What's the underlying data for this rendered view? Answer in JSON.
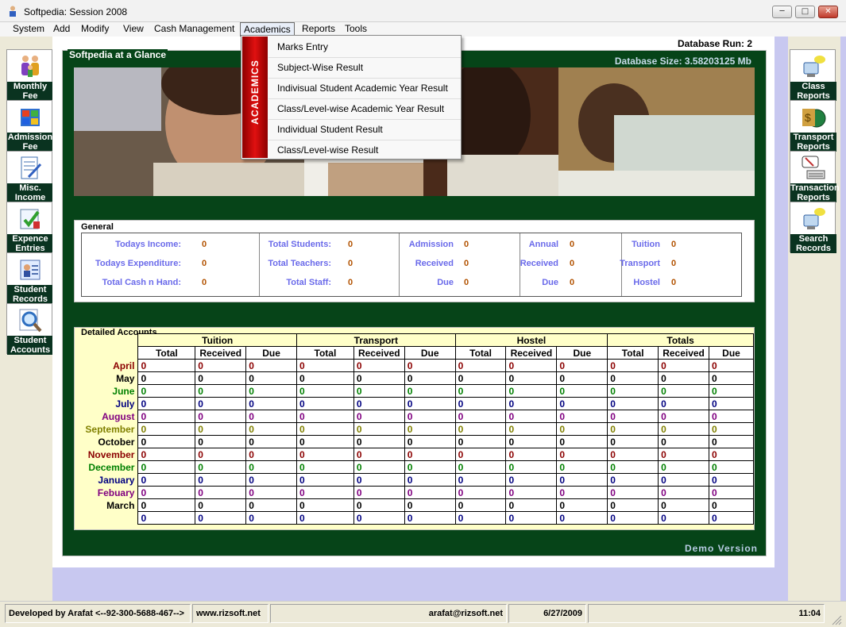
{
  "window": {
    "title": "Softpedia:  Session 2008",
    "min": "─",
    "max": "□",
    "close": "✕"
  },
  "menubar": [
    "System",
    "Add",
    "Modify",
    "View",
    "Cash Management",
    "Academics",
    "Reports",
    "Tools"
  ],
  "academics_menu": {
    "side_label": "ACADEMICS",
    "items": [
      "Marks Entry",
      "Subject-Wise Result",
      "Indivisual Student Academic Year Result",
      "Class/Level-wise Academic Year Result",
      "Individual Student Result",
      "Class/Level-wise Result"
    ]
  },
  "left_toolbar": [
    {
      "label": "Monthly Fee",
      "icon": "family-icon"
    },
    {
      "label": "Admission Fee",
      "icon": "windows-icon"
    },
    {
      "label": "Misc. Income",
      "icon": "document-edit-icon"
    },
    {
      "label": "Expence Entries",
      "icon": "checkbox-chart-icon"
    },
    {
      "label": "Student Records",
      "icon": "id-card-icon"
    },
    {
      "label": "Student Accounts",
      "icon": "magnifier-icon"
    }
  ],
  "right_toolbar": [
    {
      "label": "Class Reports",
      "icon": "computer-chat-icon"
    },
    {
      "label": "Transport Reports",
      "icon": "globe-money-icon"
    },
    {
      "label": "Transaction Reports",
      "icon": "keyboard-chat-icon"
    },
    {
      "label": "Search Records",
      "icon": "computer-search-icon"
    }
  ],
  "main": {
    "database_run": "Database Run: 2",
    "glance_title": "Softpedia at a Glance",
    "database_size": "Database Size: 3.58203125  Mb",
    "general": {
      "title": "General",
      "rows": [
        [
          {
            "l": "Todays Income:",
            "v": "0"
          },
          {
            "l": "Total Students:",
            "v": "0"
          },
          {
            "l": "Admission",
            "v": "0"
          },
          {
            "l": "Annual",
            "v": "0"
          },
          {
            "l": "Tuition",
            "v": "0"
          }
        ],
        [
          {
            "l": "Todays Expenditure:",
            "v": "0"
          },
          {
            "l": "Total Teachers:",
            "v": "0"
          },
          {
            "l": "Received",
            "v": "0"
          },
          {
            "l": "Received",
            "v": "0"
          },
          {
            "l": "Transport",
            "v": "0"
          }
        ],
        [
          {
            "l": "Total Cash n Hand:",
            "v": "0"
          },
          {
            "l": "Total Staff:",
            "v": "0"
          },
          {
            "l": "Due",
            "v": "0"
          },
          {
            "l": "Due",
            "v": "0"
          },
          {
            "l": "Hostel",
            "v": "0"
          }
        ]
      ]
    },
    "detailed": {
      "title": "Detailed Accounts",
      "groups": [
        "Tuition",
        "Transport",
        "Hostel",
        "Totals"
      ],
      "subcols": [
        "Total",
        "Received",
        "Due"
      ],
      "months": [
        {
          "name": "April",
          "color": "#8b0000"
        },
        {
          "name": "May",
          "color": "#000000"
        },
        {
          "name": "June",
          "color": "#008000"
        },
        {
          "name": "July",
          "color": "#000080"
        },
        {
          "name": "August",
          "color": "#800080"
        },
        {
          "name": "September",
          "color": "#808000"
        },
        {
          "name": "October",
          "color": "#000000"
        },
        {
          "name": "November",
          "color": "#8b0000"
        },
        {
          "name": "December",
          "color": "#008000"
        },
        {
          "name": "January",
          "color": "#000080"
        },
        {
          "name": "Febuary",
          "color": "#800080"
        },
        {
          "name": "March",
          "color": "#000000"
        },
        {
          "name": "",
          "color": "#000080"
        }
      ],
      "cell_value": "0"
    },
    "demo": "Demo Version"
  },
  "statusbar": {
    "developer": "Developed by Arafat <--92-300-5688-467-->",
    "website": "www.rizsoft.net",
    "email": "arafat@rizsoft.net",
    "date": "6/27/2009",
    "time": "11:04"
  }
}
